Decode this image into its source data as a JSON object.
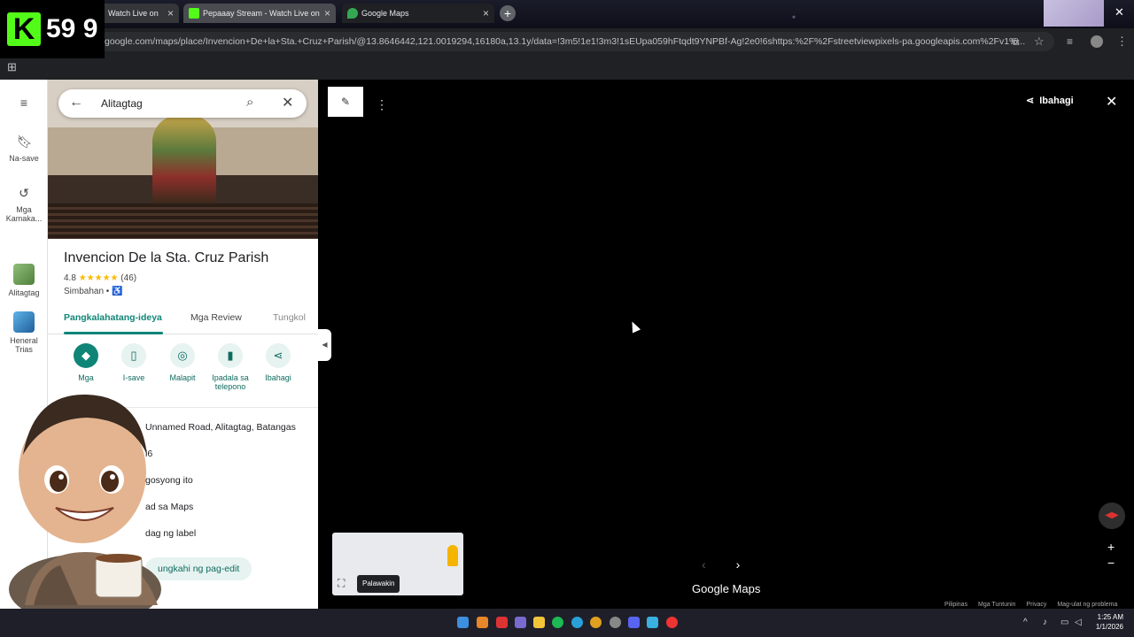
{
  "browser": {
    "tabs": [
      {
        "title": "Watch Live on",
        "favicon": "kick-icon"
      },
      {
        "title": "Pepaaay Stream - Watch Live on",
        "favicon": "kick-icon"
      },
      {
        "title": "Google Maps",
        "favicon": "maps-icon"
      }
    ],
    "new_tab": "+",
    "url": "google.com/maps/place/Invencion+De+la+Sta.+Cruz+Parish/@13.8646442,121.0019294,16180a,13.1y/data=!3m5!1e1!3m3!1sEUpa059hFtqdt9YNPBf-Ag!2e0!6shttps:%2F%2Fstreetviewpixels-pa.googleapis.com%2Fv1%..."
  },
  "overlay": {
    "logo_letter": "K",
    "counter": "59 9"
  },
  "rail": {
    "menu_icon": "≡",
    "items": [
      {
        "label": "Na-save",
        "icon": "bookmark-icon"
      },
      {
        "label": "Mga Kamaka...",
        "icon": "history-icon"
      },
      {
        "label": "Alitagtag",
        "icon": "thumbnail"
      },
      {
        "label": "Heneral Trias",
        "icon": "thumbnail"
      }
    ]
  },
  "search": {
    "query": "Alitagtag"
  },
  "place": {
    "title": "Invencion De la Sta. Cruz Parish",
    "rating": "4.8",
    "stars": "★★★★★",
    "review_count": "(46)",
    "category": "Simbahan •",
    "accessible_icon": "♿"
  },
  "place_tabs": [
    "Pangkalahatang-ideya",
    "Mga Review",
    "Tungkol"
  ],
  "actions": [
    {
      "label": "Mga",
      "icon": "directions-icon"
    },
    {
      "label": "I-save",
      "icon": "bookmark-icon"
    },
    {
      "label": "Malapit",
      "icon": "nearby-icon"
    },
    {
      "label": "Ipadala sa telepono",
      "icon": "phone-icon"
    },
    {
      "label": "Ibahagi",
      "icon": "share-icon"
    }
  ],
  "info_rows": [
    "Unnamed Road, Alitagtag, Batangas",
    "l6",
    "gosyong ito",
    "ad sa Maps",
    "dag ng label"
  ],
  "suggest_edit": "ungkahi ng pag-edit",
  "streetview": {
    "share_label": "Ibahagi",
    "close": "✕",
    "expand_tooltip": "Palawakin",
    "brand": "Google Maps",
    "footer": [
      "Pilipinas",
      "Mga Tuntunin",
      "Privacy",
      "Mag-ulat ng problema"
    ]
  },
  "taskbar": {
    "time": "1:25 AM",
    "date": "1/1/2026"
  },
  "colors": {
    "accent": "#0f8577",
    "kick_green": "#53fc18",
    "star": "#fbbc04"
  }
}
